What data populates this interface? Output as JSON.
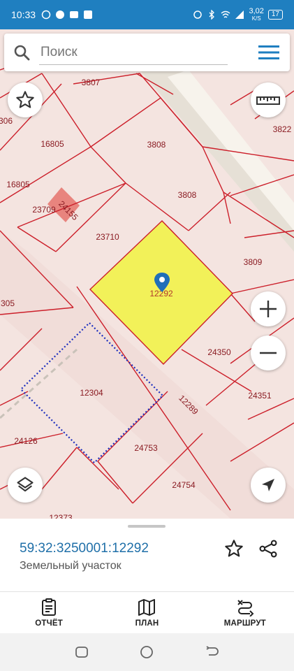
{
  "status_bar": {
    "time": "10:33",
    "net_speed": "3,02",
    "net_unit": "K/S",
    "battery": "17"
  },
  "search": {
    "placeholder": "Поиск"
  },
  "map": {
    "parcel_labels": [
      "3807",
      "306",
      "16805",
      "3808",
      "3822",
      "16805",
      "23709",
      "24155",
      "3808",
      "23710",
      "3809",
      "305",
      "12292",
      "24350",
      "12304",
      "12289",
      "24351",
      "24126",
      "24753",
      "24754",
      "12373"
    ],
    "selected_parcel_color": "#f2f24a",
    "boundary_color": "#cc1f2a",
    "highlight_boundary_color": "#1d2fbf"
  },
  "info": {
    "cadastral_number": "59:32:3250001:12292",
    "type": "Земельный участок"
  },
  "tabs": [
    {
      "label": "ОТЧЁТ",
      "icon": "report-icon"
    },
    {
      "label": "ПЛАН",
      "icon": "map-plan-icon"
    },
    {
      "label": "МАРШРУТ",
      "icon": "route-icon"
    }
  ],
  "colors": {
    "accent": "#1f7fc0",
    "link": "#1f6fa8"
  }
}
